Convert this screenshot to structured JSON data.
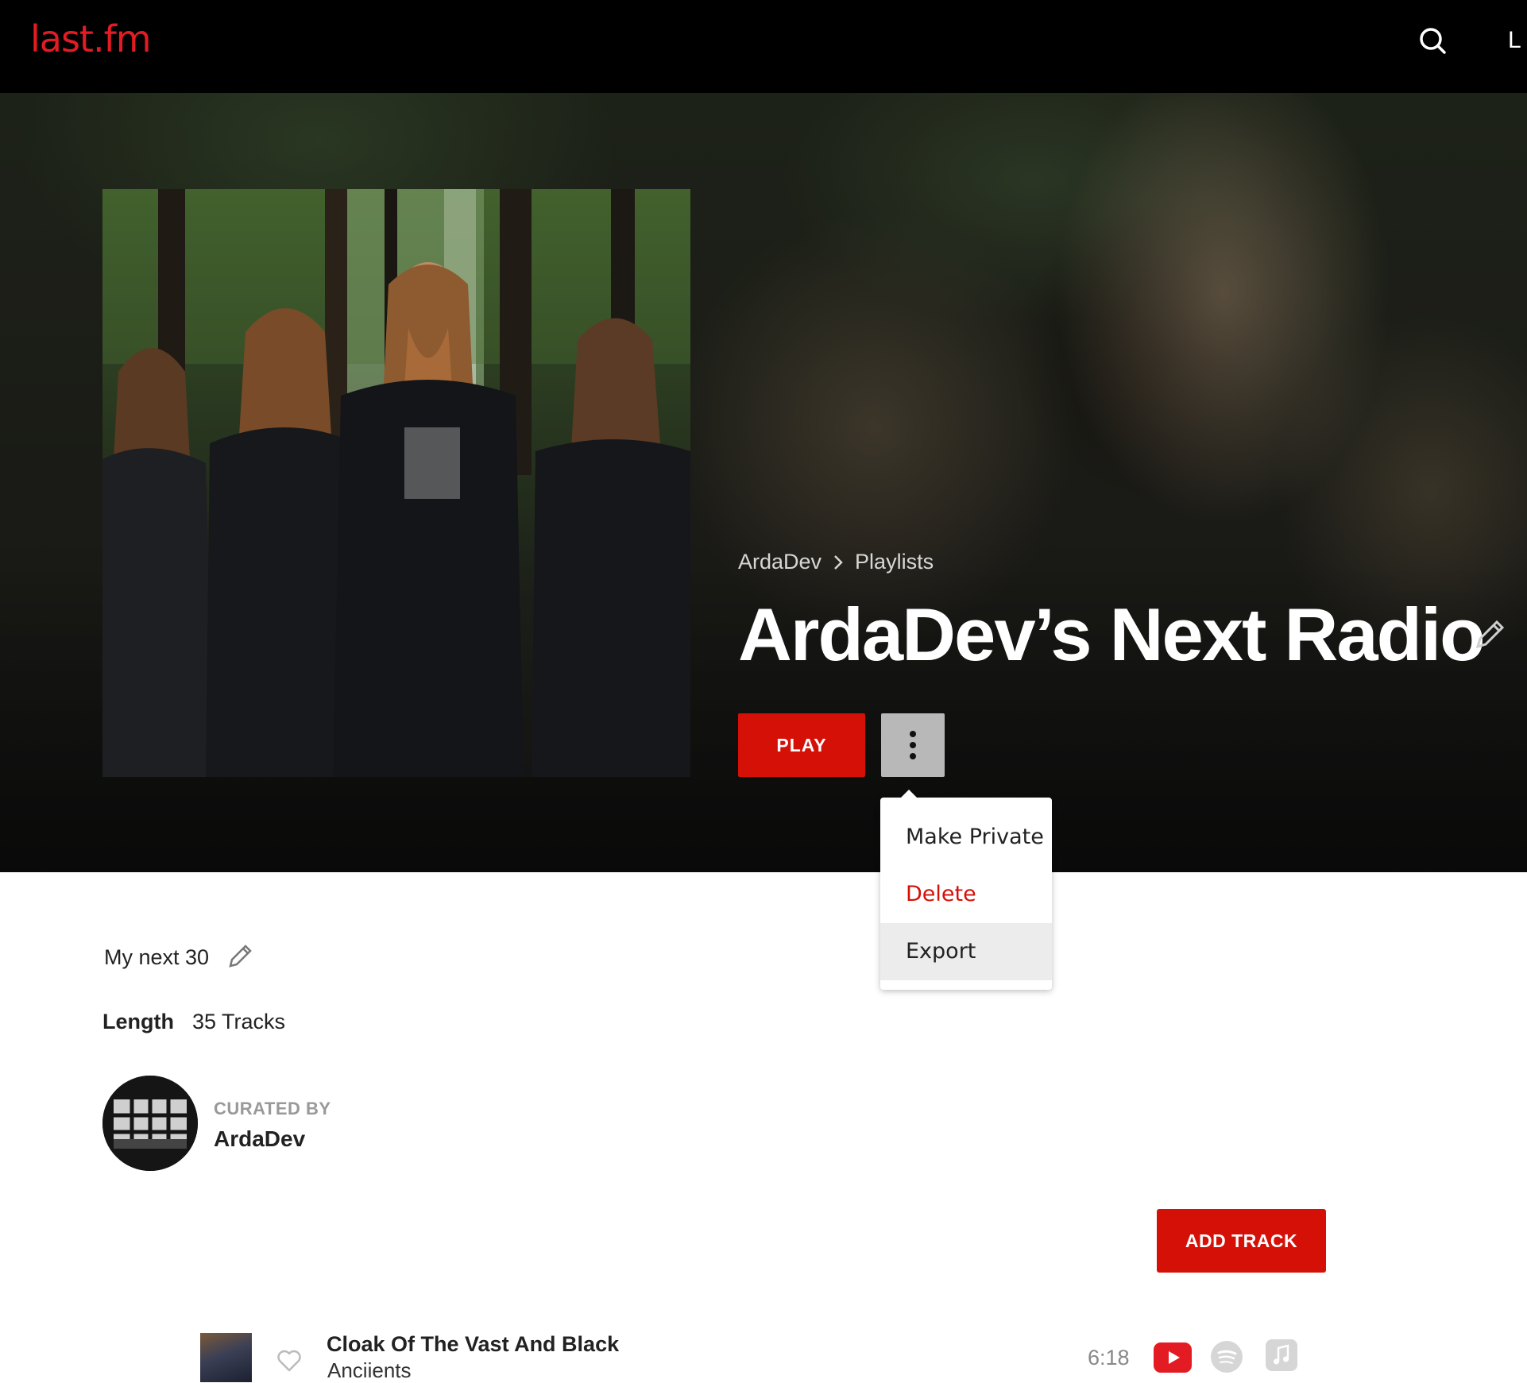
{
  "header": {
    "logo_text": "last.fm",
    "cut_text": "L"
  },
  "hero": {
    "breadcrumb": {
      "user": "ArdaDev",
      "section": "Playlists"
    },
    "title": "ArdaDev’s Next Radio",
    "play_label": "PLAY"
  },
  "menu": {
    "items": [
      {
        "label": "Make Private"
      },
      {
        "label": "Delete"
      },
      {
        "label": "Export"
      }
    ]
  },
  "playlist": {
    "description": "My next 30",
    "length_label": "Length",
    "length_value": "35 Tracks",
    "curated_by_label": "CURATED BY",
    "curator_name": "ArdaDev",
    "add_track_label": "ADD TRACK"
  },
  "tracks": [
    {
      "name": "Cloak Of The Vast And Black",
      "artist": "Anciients",
      "duration": "6:18"
    }
  ],
  "colors": {
    "brand_red": "#d51007",
    "logo_red": "#e31c23",
    "youtube_red": "#e31c23",
    "header_bg": "#000000"
  },
  "icons": {
    "search": "search-icon",
    "edit": "pencil-icon",
    "more": "vertical-dots-icon",
    "love": "heart-outline-icon",
    "youtube": "youtube-icon",
    "spotify": "spotify-icon",
    "apple_music": "apple-music-icon"
  }
}
